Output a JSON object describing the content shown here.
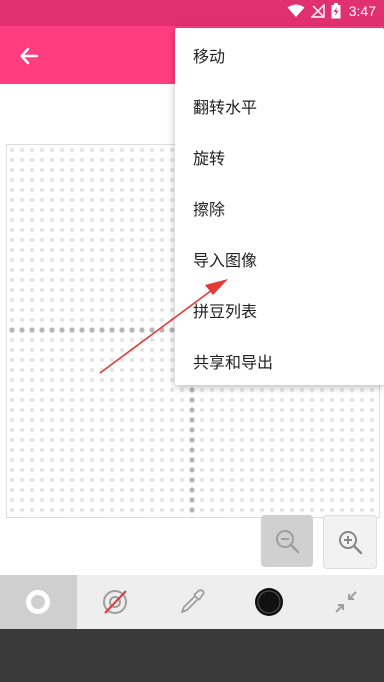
{
  "status_bar": {
    "time": "3:47",
    "icons": [
      "wifi-icon",
      "signal-icon",
      "battery-charging-icon"
    ]
  },
  "toolbar": {
    "back_icon": "arrow-left-icon",
    "color": "#ff3d7f"
  },
  "menu": {
    "items": [
      {
        "label": "移动"
      },
      {
        "label": "翻转水平"
      },
      {
        "label": "旋转"
      },
      {
        "label": "擦除"
      },
      {
        "label": "导入图像"
      },
      {
        "label": "拼豆列表"
      },
      {
        "label": "共享和导出"
      }
    ]
  },
  "canvas": {
    "grid_cols": 37,
    "grid_rows": 37
  },
  "zoom": {
    "zoom_out_icon": "zoom-out-icon",
    "zoom_in_icon": "zoom-in-icon"
  },
  "bottom_tools": [
    {
      "name": "bead-tool-icon",
      "active": true
    },
    {
      "name": "no-bead-tool-icon",
      "active": false
    },
    {
      "name": "eyedropper-icon",
      "active": false
    },
    {
      "name": "color-swatch-icon",
      "active": false
    },
    {
      "name": "collapse-icon",
      "active": false
    }
  ],
  "colors": {
    "accent": "#ff3d7f",
    "status_bar": "#e0306f",
    "annotation_arrow": "#e53935"
  }
}
